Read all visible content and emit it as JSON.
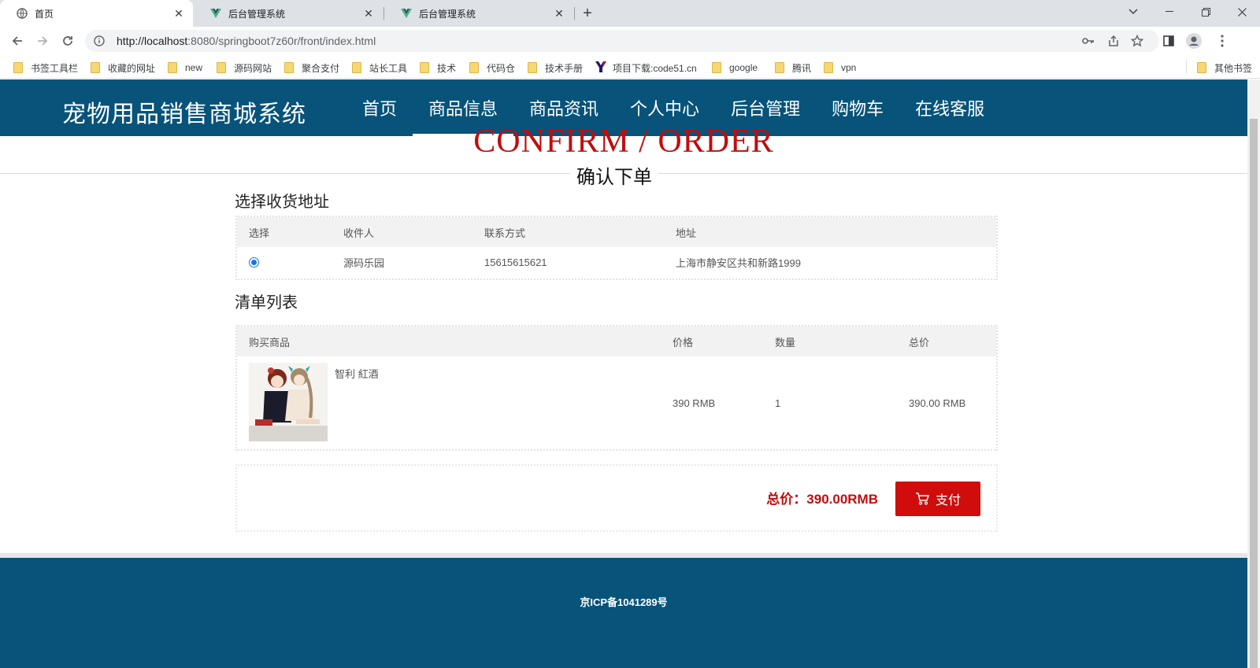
{
  "browser": {
    "tabs": [
      {
        "title": "首页",
        "active": true
      },
      {
        "title": "后台管理系统",
        "active": false
      },
      {
        "title": "后台管理系统",
        "active": false
      }
    ],
    "new_tab": "+",
    "url_host": "http://localhost",
    "url_rest": ":8080/springboot7z60r/front/index.html",
    "bookmarks": [
      "书签工具栏",
      "收藏的网址",
      "new",
      "源码网站",
      "聚合支付",
      "站长工具",
      "技术",
      "代码仓",
      "技术手册",
      "项目下载:code51.cn",
      "google",
      "腾讯",
      "vpn"
    ],
    "other_bookmarks": "其他书签"
  },
  "site": {
    "title": "宠物用品销售商城系统",
    "nav": [
      "首页",
      "商品信息",
      "商品资讯",
      "个人中心",
      "后台管理",
      "购物车",
      "在线客服"
    ],
    "active_nav": "商品信息"
  },
  "page": {
    "heading_en": "CONFIRM / ORDER",
    "heading_cn": "确认下单",
    "address_section_title": "选择收货地址",
    "address_headers": [
      "选择",
      "收件人",
      "联系方式",
      "地址"
    ],
    "address": {
      "name": "源码乐园",
      "phone": "15615615621",
      "address": "上海市静安区共和新路1999",
      "selected": true
    },
    "list_section_title": "清单列表",
    "list_headers": [
      "购买商品",
      "价格",
      "数量",
      "总价"
    ],
    "item": {
      "name": "智利 紅酒",
      "price": "390 RMB",
      "quantity": "1",
      "total": "390.00 RMB"
    },
    "total_label": "总价：390.00RMB",
    "pay_label": "支付"
  },
  "footer": {
    "icp": "京ICP备1041289号"
  },
  "colors": {
    "brand": "#07537a",
    "accent_red": "#c00d0d",
    "pay_button": "#d10c0c"
  }
}
